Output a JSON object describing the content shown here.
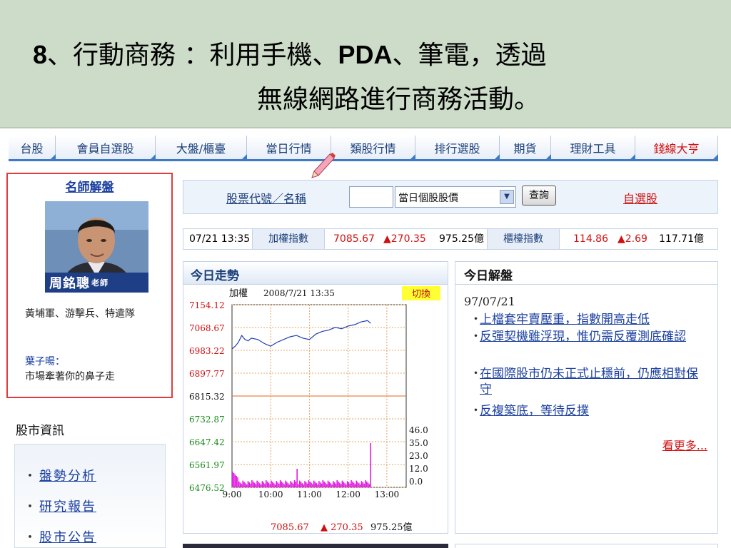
{
  "slide": {
    "num": "8",
    "sep1": "、行動商務 ：利用手機、",
    "pda": "PDA",
    "sep2": "、筆電，透過",
    "line2": "無線網路進行商務活動。"
  },
  "nav": [
    {
      "label": "台股",
      "w": 66
    },
    {
      "label": "會員自選股",
      "w": 140
    },
    {
      "label": "大盤/櫃臺",
      "w": 128
    },
    {
      "label": "當日行情",
      "w": 118
    },
    {
      "label": "類股行情",
      "w": 118
    },
    {
      "label": "排行選股",
      "w": 118
    },
    {
      "label": "期貨",
      "w": 72
    },
    {
      "label": "理財工具",
      "w": 118
    },
    {
      "label": "錢線大亨",
      "w": 116
    }
  ],
  "mentor": {
    "title": "名師解盤",
    "name_plate": "周銘聰",
    "name_suffix": "老師",
    "desc": "黃埔軍、游擊兵、特遣隊",
    "mentor2_name": "葉子暘：",
    "mentor2_desc": "市場牽著你的鼻子走"
  },
  "side": {
    "title": "股市資訊",
    "links": [
      "盤勢分析",
      "研究報告",
      "股市公告"
    ]
  },
  "search": {
    "label": "股票代號／名稱",
    "select_value": "當日個股股價",
    "button": "查詢",
    "self_link": "自選股"
  },
  "ticker": {
    "time": "07/21 13:35",
    "index1_label": "加權指數",
    "index1_value": "7085.67",
    "index1_change": "▲270.35",
    "index1_volume": "975.25億",
    "index2_label": "櫃檯指數",
    "index2_value": "114.86",
    "index2_change": "▲2.69",
    "index2_volume": "117.71億"
  },
  "trend": {
    "title": "今日走勢",
    "switch_label": "切換",
    "footer_value": "7085.67",
    "footer_change": "▲ 270.35",
    "footer_volume": "975.25億"
  },
  "chart_data": {
    "type": "line",
    "title": "加權",
    "subtitle": "2008/7/21 13:35",
    "ylim": [
      6476.52,
      7154.12
    ],
    "y_ticks": [
      7154.12,
      7068.67,
      6983.22,
      6897.77,
      6815.32,
      6732.87,
      6647.42,
      6561.97,
      6476.52
    ],
    "x_ticks": [
      "9:00",
      "10:00",
      "11:00",
      "12:00",
      "13:00"
    ],
    "volume_ticks": [
      "46.0",
      "35.0",
      "23.0",
      "12.0",
      "0.0"
    ],
    "x": [
      0,
      5,
      10,
      15,
      20,
      25,
      30,
      40,
      50,
      60,
      70,
      80,
      90,
      100,
      110,
      120,
      130,
      140,
      150,
      160,
      170,
      180,
      190,
      200,
      210,
      215
    ],
    "values": [
      6990,
      7000,
      7015,
      7040,
      7025,
      7020,
      7030,
      7025,
      7010,
      7000,
      7015,
      7025,
      7035,
      7040,
      7030,
      7025,
      7045,
      7055,
      7060,
      7070,
      7065,
      7075,
      7080,
      7090,
      7095,
      7085
    ]
  },
  "analysis": {
    "title": "今日解盤",
    "date": "97/07/21",
    "items": [
      "上檔套牢賣壓重，指數開高走低",
      "反彈契機雖浮現，惟仍需反覆測底確認",
      "在國際股市仍未正式止穩前，仍應相對保守",
      "反複築底，等待反撲"
    ],
    "more": "看更多..."
  }
}
